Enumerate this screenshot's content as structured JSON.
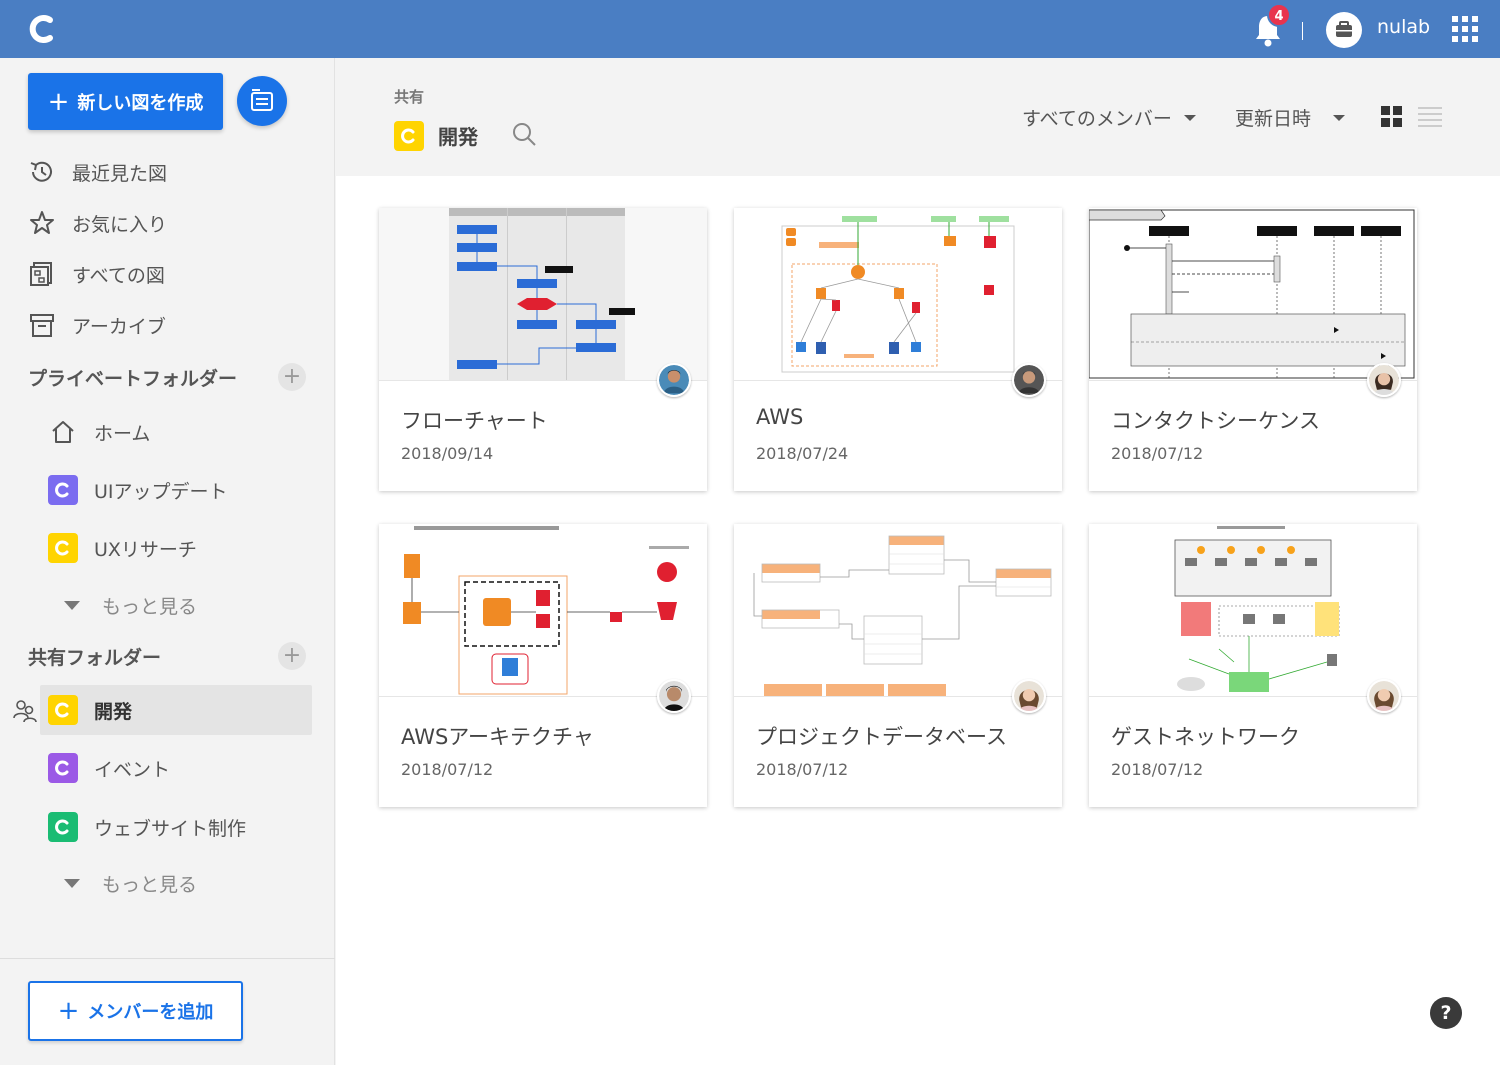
{
  "topbar": {
    "notification_count": "4",
    "org_name": "nulab"
  },
  "sidebar": {
    "create_label": "新しい図を作成",
    "nav": [
      {
        "label": "最近見た図",
        "icon": "history-icon"
      },
      {
        "label": "お気に入り",
        "icon": "star-icon"
      },
      {
        "label": "すべての図",
        "icon": "all-diagrams-icon"
      },
      {
        "label": "アーカイブ",
        "icon": "archive-icon"
      }
    ],
    "private_title": "プライベートフォルダー",
    "home_label": "ホーム",
    "private_folders": [
      {
        "label": "UIアップデート",
        "color": "#7b6cf0"
      },
      {
        "label": "UXリサーチ",
        "color": "#ffd400"
      }
    ],
    "more_label_1": "もっと見る",
    "shared_title": "共有フォルダー",
    "shared_folders": [
      {
        "label": "開発",
        "color": "#ffd400"
      },
      {
        "label": "イベント",
        "color": "#9b59e6"
      },
      {
        "label": "ウェブサイト制作",
        "color": "#1abc73"
      }
    ],
    "more_label_2": "もっと見る",
    "add_member_label": "メンバーを追加"
  },
  "header": {
    "crumb": "共有",
    "title": "開発",
    "member_filter": "すべてのメンバー",
    "sort": "更新日時"
  },
  "cards": [
    {
      "title": "フローチャート",
      "date": "2018/09/14"
    },
    {
      "title": "AWS",
      "date": "2018/07/24"
    },
    {
      "title": "コンタクトシーケンス",
      "date": "2018/07/12"
    },
    {
      "title": "AWSアーキテクチャ",
      "date": "2018/07/12"
    },
    {
      "title": "プロジェクトデータベース",
      "date": "2018/07/12"
    },
    {
      "title": "ゲストネットワーク",
      "date": "2018/07/12"
    }
  ],
  "help_label": "?",
  "colors": {
    "topbar": "#4a7ec3",
    "primary": "#1a73e8",
    "badge": "#e8344e"
  }
}
